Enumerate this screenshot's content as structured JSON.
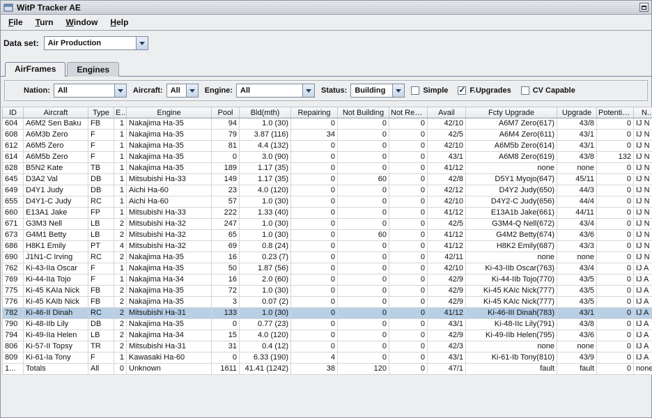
{
  "window": {
    "title": "WitP Tracker AE"
  },
  "menu": {
    "items": [
      {
        "label": "File"
      },
      {
        "label": "Turn"
      },
      {
        "label": "Window"
      },
      {
        "label": "Help"
      }
    ]
  },
  "dataset": {
    "label": "Data set:",
    "value": "Air Production"
  },
  "tabs": [
    {
      "label": "AirFrames"
    },
    {
      "label": "Engines"
    }
  ],
  "filters": {
    "nation": {
      "label": "Nation:",
      "value": "All"
    },
    "aircraft": {
      "label": "Aircraft:",
      "value": "All"
    },
    "engine": {
      "label": "Engine:",
      "value": "All"
    },
    "status": {
      "label": "Status:",
      "value": "Building"
    },
    "checkboxes": [
      {
        "label": "Simple",
        "checked": false
      },
      {
        "label": "F.Upgrades",
        "checked": true
      },
      {
        "label": "CV Capable",
        "checked": false
      }
    ]
  },
  "table": {
    "columns": [
      "ID",
      "Aircraft",
      "Type",
      "E#",
      "Engine",
      "Pool",
      "Bld(mth)",
      "Repairing",
      "Not Building",
      "Not Repairi...",
      "Avail",
      "Fcty Upgrade",
      "Upgrade",
      "Potential...",
      "N..."
    ],
    "selected_row_id": "782",
    "rows": [
      [
        "604",
        "A6M2 Sen Baku",
        "FB",
        "1",
        "Nakajima Ha-35",
        "94",
        "1.0 (30)",
        "0",
        "0",
        "0",
        "42/10",
        "A6M7 Zero(617)",
        "43/8",
        "0",
        "IJ N"
      ],
      [
        "608",
        "A6M3b Zero",
        "F",
        "1",
        "Nakajima Ha-35",
        "79",
        "3.87 (116)",
        "34",
        "0",
        "0",
        "42/5",
        "A6M4 Zero(611)",
        "43/1",
        "0",
        "IJ N"
      ],
      [
        "612",
        "A6M5 Zero",
        "F",
        "1",
        "Nakajima Ha-35",
        "81",
        "4.4 (132)",
        "0",
        "0",
        "0",
        "42/10",
        "A6M5b Zero(614)",
        "43/1",
        "0",
        "IJ N"
      ],
      [
        "614",
        "A6M5b Zero",
        "F",
        "1",
        "Nakajima Ha-35",
        "0",
        "3.0 (90)",
        "0",
        "0",
        "0",
        "43/1",
        "A6M8 Zero(619)",
        "43/8",
        "132",
        "IJ N"
      ],
      [
        "628",
        "B5N2 Kate",
        "TB",
        "1",
        "Nakajima Ha-35",
        "189",
        "1.17 (35)",
        "0",
        "0",
        "0",
        "41/12",
        "none",
        "none",
        "0",
        "IJ N"
      ],
      [
        "645",
        "D3A2 Val",
        "DB",
        "1",
        "Mitsubishi Ha-33",
        "149",
        "1.17 (35)",
        "0",
        "60",
        "0",
        "42/8",
        "D5Y1 Myojo(647)",
        "45/11",
        "0",
        "IJ N"
      ],
      [
        "649",
        "D4Y1 Judy",
        "DB",
        "1",
        "Aichi Ha-60",
        "23",
        "4.0 (120)",
        "0",
        "0",
        "0",
        "42/12",
        "D4Y2 Judy(650)",
        "44/3",
        "0",
        "IJ N"
      ],
      [
        "655",
        "D4Y1-C Judy",
        "RC",
        "1",
        "Aichi Ha-60",
        "57",
        "1.0 (30)",
        "0",
        "0",
        "0",
        "42/10",
        "D4Y2-C Judy(656)",
        "44/4",
        "0",
        "IJ N"
      ],
      [
        "660",
        "E13A1 Jake",
        "FP",
        "1",
        "Mitsubishi Ha-33",
        "222",
        "1.33 (40)",
        "0",
        "0",
        "0",
        "41/12",
        "E13A1b Jake(661)",
        "44/11",
        "0",
        "IJ N"
      ],
      [
        "671",
        "G3M3 Nell",
        "LB",
        "2",
        "Mitsubishi Ha-32",
        "247",
        "1.0 (30)",
        "0",
        "0",
        "0",
        "42/5",
        "G3M4-Q Nell(672)",
        "43/4",
        "0",
        "IJ N"
      ],
      [
        "673",
        "G4M1 Betty",
        "LB",
        "2",
        "Mitsubishi Ha-32",
        "65",
        "1.0 (30)",
        "0",
        "60",
        "0",
        "41/12",
        "G4M2 Betty(674)",
        "43/6",
        "0",
        "IJ N"
      ],
      [
        "686",
        "H8K1 Emily",
        "PT",
        "4",
        "Mitsubishi Ha-32",
        "69",
        "0.8 (24)",
        "0",
        "0",
        "0",
        "41/12",
        "H8K2 Emily(687)",
        "43/3",
        "0",
        "IJ N"
      ],
      [
        "690",
        "J1N1-C Irving",
        "RC",
        "2",
        "Nakajima Ha-35",
        "16",
        "0.23 (7)",
        "0",
        "0",
        "0",
        "42/11",
        "none",
        "none",
        "0",
        "IJ N"
      ],
      [
        "762",
        "Ki-43-IIa Oscar",
        "F",
        "1",
        "Nakajima Ha-35",
        "50",
        "1.87 (56)",
        "0",
        "0",
        "0",
        "42/10",
        "Ki-43-IIb Oscar(763)",
        "43/4",
        "0",
        "IJ A"
      ],
      [
        "769",
        "Ki-44-IIa Tojo",
        "F",
        "1",
        "Nakajima Ha-34",
        "16",
        "2.0 (60)",
        "0",
        "0",
        "0",
        "42/9",
        "Ki-44-IIb Tojo(770)",
        "43/5",
        "0",
        "IJ A"
      ],
      [
        "775",
        "Ki-45 KAIa Nick",
        "FB",
        "2",
        "Nakajima Ha-35",
        "72",
        "1.0 (30)",
        "0",
        "0",
        "0",
        "42/9",
        "Ki-45 KAIc Nick(777)",
        "43/5",
        "0",
        "IJ A"
      ],
      [
        "776",
        "Ki-45 KAIb Nick",
        "FB",
        "2",
        "Nakajima Ha-35",
        "3",
        "0.07 (2)",
        "0",
        "0",
        "0",
        "42/9",
        "Ki-45 KAIc Nick(777)",
        "43/5",
        "0",
        "IJ A"
      ],
      [
        "782",
        "Ki-46-II Dinah",
        "RC",
        "2",
        "Mitsubishi Ha-31",
        "133",
        "1.0 (30)",
        "0",
        "0",
        "0",
        "41/12",
        "Ki-46-III Dinah(783)",
        "43/1",
        "0",
        "IJ A"
      ],
      [
        "790",
        "Ki-48-IIb Lily",
        "DB",
        "2",
        "Nakajima Ha-35",
        "0",
        "0.77 (23)",
        "0",
        "0",
        "0",
        "43/1",
        "Ki-48-IIc Lily(791)",
        "43/8",
        "0",
        "IJ A"
      ],
      [
        "794",
        "Ki-49-IIa Helen",
        "LB",
        "2",
        "Nakajima Ha-34",
        "15",
        "4.0 (120)",
        "0",
        "0",
        "0",
        "42/9",
        "Ki-49-IIb Helen(795)",
        "43/6",
        "0",
        "IJ A"
      ],
      [
        "806",
        "Ki-57-II Topsy",
        "TR",
        "2",
        "Mitsubishi Ha-31",
        "31",
        "0.4 (12)",
        "0",
        "0",
        "0",
        "42/3",
        "none",
        "none",
        "0",
        "IJ A"
      ],
      [
        "809",
        "Ki-61-Ia Tony",
        "F",
        "1",
        "Kawasaki Ha-60",
        "0",
        "6.33 (190)",
        "4",
        "0",
        "0",
        "43/1",
        "Ki-61-Ib Tony(810)",
        "43/9",
        "0",
        "IJ A"
      ],
      [
        "1...",
        "Totals",
        "All",
        "0",
        "Unknown",
        "1611",
        "41.41 (1242)",
        "38",
        "120",
        "0",
        "47/1",
        "fault",
        "fault",
        "0",
        "none"
      ]
    ]
  },
  "colors": {
    "selection": "#B8CFE5"
  }
}
